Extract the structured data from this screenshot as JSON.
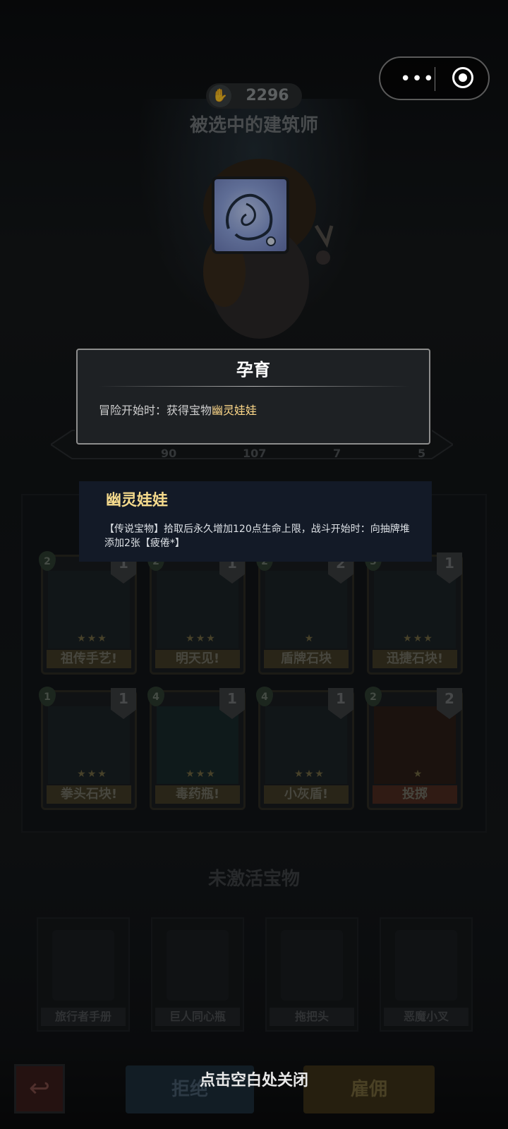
{
  "header": {
    "score": "2296",
    "builder_title": "被选中的建筑师",
    "more_icon": "more-dots-icon",
    "close_icon": "target-close-icon"
  },
  "talent_modal": {
    "title": "孕育",
    "desc_prefix": "冒险开始时：获得宝物",
    "desc_highlight": "幽灵娃娃"
  },
  "stats": [
    "90",
    "107",
    "7",
    "5"
  ],
  "relic_tooltip": {
    "name": "幽灵娃娃",
    "text": "【传说宝物】拾取后永久增加120点生命上限，战斗开始时：向抽牌堆添加2张【疲倦*】"
  },
  "cards": [
    {
      "label": "祖传手艺!",
      "cost": "2",
      "tier": "1"
    },
    {
      "label": "明天见!",
      "cost": "2",
      "tier": "1"
    },
    {
      "label": "盾牌石块",
      "cost": "2",
      "tier": "2"
    },
    {
      "label": "迅捷石块!",
      "cost": "3",
      "tier": "1"
    },
    {
      "label": "拳头石块!",
      "cost": "1",
      "tier": "1"
    },
    {
      "label": "毒药瓶!",
      "cost": "4",
      "tier": "1"
    },
    {
      "label": "小灰盾!",
      "cost": "4",
      "tier": "1"
    },
    {
      "label": "投掷",
      "cost": "2",
      "tier": "2"
    }
  ],
  "inactive": {
    "title": "未激活宝物",
    "items": [
      "旅行者手册",
      "巨人同心瓶",
      "拖把头",
      "恶魔小叉"
    ]
  },
  "bottom": {
    "reject": "拒绝",
    "hire": "雇佣",
    "close_hint": "点击空白处关闭"
  },
  "colors": {
    "highlight": "#ffd98a",
    "tooltip_bg": "#131a27",
    "modal_bg": "#1e2124"
  }
}
